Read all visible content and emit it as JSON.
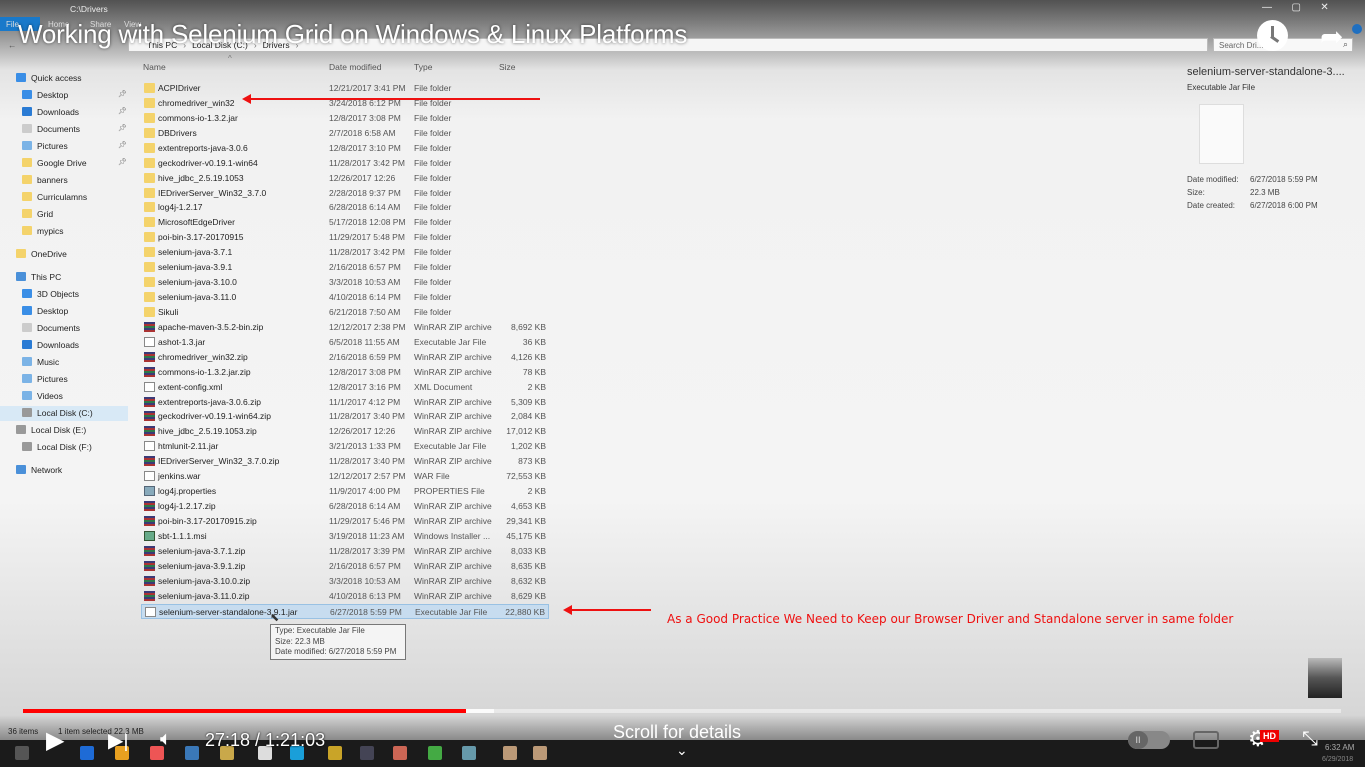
{
  "video": {
    "title": "Working with Selenium Grid on Windows & Linux Platforms",
    "time": "27:18 / 1:21:03",
    "scroll_hint": "Scroll for details",
    "progress_fraction": 0.336,
    "buffered_fraction": 0.357,
    "hd_badge": "HD"
  },
  "explorer": {
    "window_title": "C:\\Drivers",
    "ribbon": [
      "File",
      "Home",
      "Share",
      "View"
    ],
    "breadcrumb": [
      "This PC",
      "Local Disk (C:)",
      "Drivers"
    ],
    "search_placeholder": "Search Dri...",
    "columns": {
      "name": "Name",
      "date": "Date modified",
      "type": "Type",
      "size": "Size"
    },
    "status": {
      "items": "36 items",
      "selected": "1 item selected  22.3 MB"
    },
    "nav": [
      {
        "label": "Quick access",
        "kind": "star"
      },
      {
        "label": "Desktop",
        "kind": "blue"
      },
      {
        "label": "Downloads",
        "kind": "down"
      },
      {
        "label": "Documents",
        "kind": "doc"
      },
      {
        "label": "Pictures",
        "kind": "pic"
      },
      {
        "label": "Google Drive",
        "kind": "folder"
      },
      {
        "label": "banners",
        "kind": "folder"
      },
      {
        "label": "Curriculamns",
        "kind": "folder"
      },
      {
        "label": "Grid",
        "kind": "folder"
      },
      {
        "label": "mypics",
        "kind": "folder"
      },
      {
        "label": "OneDrive",
        "kind": "folder"
      },
      {
        "label": "This PC",
        "kind": "pc"
      },
      {
        "label": "3D Objects",
        "kind": "blue"
      },
      {
        "label": "Desktop",
        "kind": "blue"
      },
      {
        "label": "Documents",
        "kind": "doc"
      },
      {
        "label": "Downloads",
        "kind": "down"
      },
      {
        "label": "Music",
        "kind": "pic"
      },
      {
        "label": "Pictures",
        "kind": "pic"
      },
      {
        "label": "Videos",
        "kind": "pic"
      },
      {
        "label": "Local Disk (C:)",
        "kind": "disk"
      },
      {
        "label": "Local Disk (E:)",
        "kind": "disk"
      },
      {
        "label": "Local Disk (F:)",
        "kind": "disk"
      },
      {
        "label": "Network",
        "kind": "pc"
      }
    ],
    "files": [
      {
        "name": "ACPIDriver",
        "date": "12/21/2017 3:41 PM",
        "type": "File folder",
        "size": "",
        "icon": "fold"
      },
      {
        "name": "chromedriver_win32",
        "date": "3/24/2018 6:12 PM",
        "type": "File folder",
        "size": "",
        "icon": "fold"
      },
      {
        "name": "commons-io-1.3.2.jar",
        "date": "12/8/2017 3:08 PM",
        "type": "File folder",
        "size": "",
        "icon": "fold"
      },
      {
        "name": "DBDrivers",
        "date": "2/7/2018 6:58 AM",
        "type": "File folder",
        "size": "",
        "icon": "fold"
      },
      {
        "name": "extentreports-java-3.0.6",
        "date": "12/8/2017 3:10 PM",
        "type": "File folder",
        "size": "",
        "icon": "fold"
      },
      {
        "name": "geckodriver-v0.19.1-win64",
        "date": "11/28/2017 3:42 PM",
        "type": "File folder",
        "size": "",
        "icon": "fold"
      },
      {
        "name": "hive_jdbc_2.5.19.1053",
        "date": "12/26/2017 12:26",
        "type": "File folder",
        "size": "",
        "icon": "fold"
      },
      {
        "name": "IEDriverServer_Win32_3.7.0",
        "date": "2/28/2018 9:37 PM",
        "type": "File folder",
        "size": "",
        "icon": "fold"
      },
      {
        "name": "log4j-1.2.17",
        "date": "6/28/2018 6:14 AM",
        "type": "File folder",
        "size": "",
        "icon": "fold"
      },
      {
        "name": "MicrosoftEdgeDriver",
        "date": "5/17/2018 12:08 PM",
        "type": "File folder",
        "size": "",
        "icon": "fold"
      },
      {
        "name": "poi-bin-3.17-20170915",
        "date": "11/29/2017 5:48 PM",
        "type": "File folder",
        "size": "",
        "icon": "fold"
      },
      {
        "name": "selenium-java-3.7.1",
        "date": "11/28/2017 3:42 PM",
        "type": "File folder",
        "size": "",
        "icon": "fold"
      },
      {
        "name": "selenium-java-3.9.1",
        "date": "2/16/2018 6:57 PM",
        "type": "File folder",
        "size": "",
        "icon": "fold"
      },
      {
        "name": "selenium-java-3.10.0",
        "date": "3/3/2018 10:53 AM",
        "type": "File folder",
        "size": "",
        "icon": "fold"
      },
      {
        "name": "selenium-java-3.11.0",
        "date": "4/10/2018 6:14 PM",
        "type": "File folder",
        "size": "",
        "icon": "fold"
      },
      {
        "name": "Sikuli",
        "date": "6/21/2018 7:50 AM",
        "type": "File folder",
        "size": "",
        "icon": "fold"
      },
      {
        "name": "apache-maven-3.5.2-bin.zip",
        "date": "12/12/2017 2:38 PM",
        "type": "WinRAR ZIP archive",
        "size": "8,692 KB",
        "icon": "zip"
      },
      {
        "name": "ashot-1.3.jar",
        "date": "6/5/2018 11:55 AM",
        "type": "Executable Jar File",
        "size": "36 KB",
        "icon": "doc"
      },
      {
        "name": "chromedriver_win32.zip",
        "date": "2/16/2018 6:59 PM",
        "type": "WinRAR ZIP archive",
        "size": "4,126 KB",
        "icon": "zip"
      },
      {
        "name": "commons-io-1.3.2.jar.zip",
        "date": "12/8/2017 3:08 PM",
        "type": "WinRAR ZIP archive",
        "size": "78 KB",
        "icon": "zip"
      },
      {
        "name": "extent-config.xml",
        "date": "12/8/2017 3:16 PM",
        "type": "XML Document",
        "size": "2 KB",
        "icon": "doc"
      },
      {
        "name": "extentreports-java-3.0.6.zip",
        "date": "11/1/2017 4:12 PM",
        "type": "WinRAR ZIP archive",
        "size": "5,309 KB",
        "icon": "zip"
      },
      {
        "name": "geckodriver-v0.19.1-win64.zip",
        "date": "11/28/2017 3:40 PM",
        "type": "WinRAR ZIP archive",
        "size": "2,084 KB",
        "icon": "zip"
      },
      {
        "name": "hive_jdbc_2.5.19.1053.zip",
        "date": "12/26/2017 12:26",
        "type": "WinRAR ZIP archive",
        "size": "17,012 KB",
        "icon": "zip"
      },
      {
        "name": "htmlunit-2.11.jar",
        "date": "3/21/2013 1:33 PM",
        "type": "Executable Jar File",
        "size": "1,202 KB",
        "icon": "doc"
      },
      {
        "name": "IEDriverServer_Win32_3.7.0.zip",
        "date": "11/28/2017 3:40 PM",
        "type": "WinRAR ZIP archive",
        "size": "873 KB",
        "icon": "zip"
      },
      {
        "name": "jenkins.war",
        "date": "12/12/2017 2:57 PM",
        "type": "WAR File",
        "size": "72,553 KB",
        "icon": "doc"
      },
      {
        "name": "log4j.properties",
        "date": "11/9/2017 4:00 PM",
        "type": "PROPERTIES File",
        "size": "2 KB",
        "icon": "prop"
      },
      {
        "name": "log4j-1.2.17.zip",
        "date": "6/28/2018 6:14 AM",
        "type": "WinRAR ZIP archive",
        "size": "4,653 KB",
        "icon": "zip"
      },
      {
        "name": "poi-bin-3.17-20170915.zip",
        "date": "11/29/2017 5:46 PM",
        "type": "WinRAR ZIP archive",
        "size": "29,341 KB",
        "icon": "zip"
      },
      {
        "name": "sbt-1.1.1.msi",
        "date": "3/19/2018 11:23 AM",
        "type": "Windows Installer ...",
        "size": "45,175 KB",
        "icon": "msi"
      },
      {
        "name": "selenium-java-3.7.1.zip",
        "date": "11/28/2017 3:39 PM",
        "type": "WinRAR ZIP archive",
        "size": "8,033 KB",
        "icon": "zip"
      },
      {
        "name": "selenium-java-3.9.1.zip",
        "date": "2/16/2018 6:57 PM",
        "type": "WinRAR ZIP archive",
        "size": "8,635 KB",
        "icon": "zip"
      },
      {
        "name": "selenium-java-3.10.0.zip",
        "date": "3/3/2018 10:53 AM",
        "type": "WinRAR ZIP archive",
        "size": "8,632 KB",
        "icon": "zip"
      },
      {
        "name": "selenium-java-3.11.0.zip",
        "date": "4/10/2018 6:13 PM",
        "type": "WinRAR ZIP archive",
        "size": "8,629 KB",
        "icon": "zip"
      },
      {
        "name": "selenium-server-standalone-3.9.1.jar",
        "date": "6/27/2018 5:59 PM",
        "type": "Executable Jar File",
        "size": "22,880 KB",
        "icon": "doc",
        "selected": true
      }
    ],
    "tooltip": [
      "Type: Executable Jar File",
      "Size: 22.3 MB",
      "Date modified: 6/27/2018 5:59 PM"
    ],
    "preview": {
      "name": "selenium-server-standalone-3....",
      "type": "Executable Jar File",
      "labels": [
        "Date modified:",
        "Size:",
        "Date created:"
      ],
      "values": [
        "6/27/2018 5:59 PM",
        "22.3 MB",
        "6/27/2018 6:00 PM"
      ]
    }
  },
  "annotation": "As a Good Practice We Need to Keep our Browser Driver and Standalone server in same folder",
  "taskbar": {
    "time": "6:32 AM",
    "date": "6/29/2018"
  }
}
